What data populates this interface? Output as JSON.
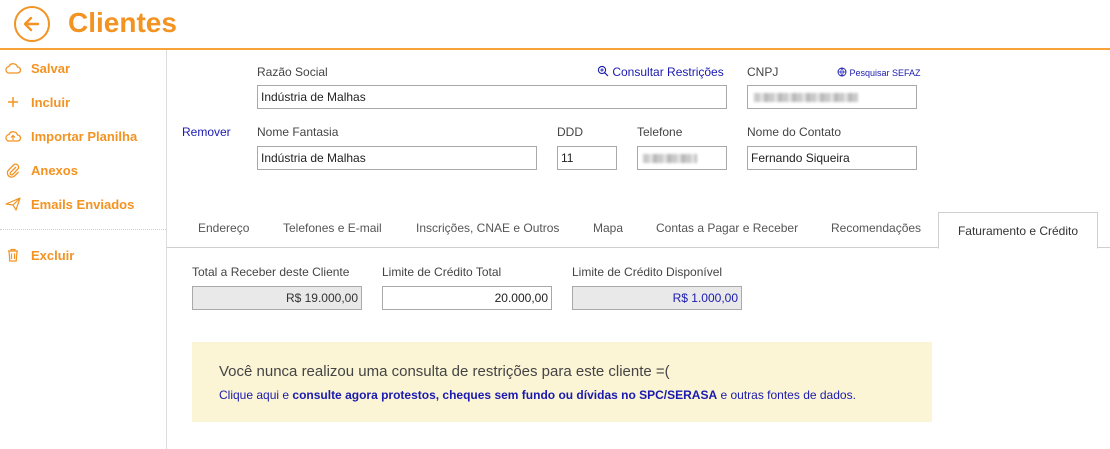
{
  "header": {
    "title": "Clientes"
  },
  "sidebar": {
    "items": [
      {
        "label": "Salvar",
        "icon": "cloud-icon"
      },
      {
        "label": "Incluir",
        "icon": "plus-icon"
      },
      {
        "label": "Importar Planilha",
        "icon": "cloud-upload-icon"
      },
      {
        "label": "Anexos",
        "icon": "paperclip-icon"
      },
      {
        "label": "Emails Enviados",
        "icon": "paper-plane-icon"
      },
      {
        "label": "Excluir",
        "icon": "trash-icon"
      }
    ]
  },
  "form": {
    "razao_social_label": "Razão Social",
    "razao_social_value": "Indústria de Malhas",
    "consultar_link": "Consultar Restrições",
    "cnpj_label": "CNPJ",
    "sefaz_link": "Pesquisar SEFAZ",
    "remover_link": "Remover",
    "nome_fantasia_label": "Nome Fantasia",
    "nome_fantasia_value": "Indústria de Malhas",
    "ddd_label": "DDD",
    "ddd_value": "11",
    "telefone_label": "Telefone",
    "contato_label": "Nome do Contato",
    "contato_value": "Fernando Siqueira"
  },
  "tabs": [
    {
      "label": "Endereço"
    },
    {
      "label": "Telefones e E-mail"
    },
    {
      "label": "Inscrições, CNAE e Outros"
    },
    {
      "label": "Mapa"
    },
    {
      "label": "Contas a Pagar e Receber"
    },
    {
      "label": "Recomendações"
    },
    {
      "label": "Faturamento e Crédito",
      "active": true
    }
  ],
  "credit": {
    "total_label": "Total a Receber deste Cliente",
    "total_value": "R$ 19.000,00",
    "limite_label": "Limite de Crédito Total",
    "limite_value": "20.000,00",
    "disponivel_label": "Limite de Crédito Disponível",
    "disponivel_value": "R$ 1.000,00"
  },
  "notice": {
    "title": "Você nunca realizou uma consulta de restrições para este cliente =(",
    "part1": "Clique aqui",
    "part2": " e ",
    "part3": "consulte agora protestos, cheques sem fundo ou dívidas no SPC/SERASA",
    "part4": " e outras fontes de dados."
  },
  "colors": {
    "accent": "#f39322",
    "link": "#1a1ab0",
    "notice_bg": "#fbf5d6"
  }
}
